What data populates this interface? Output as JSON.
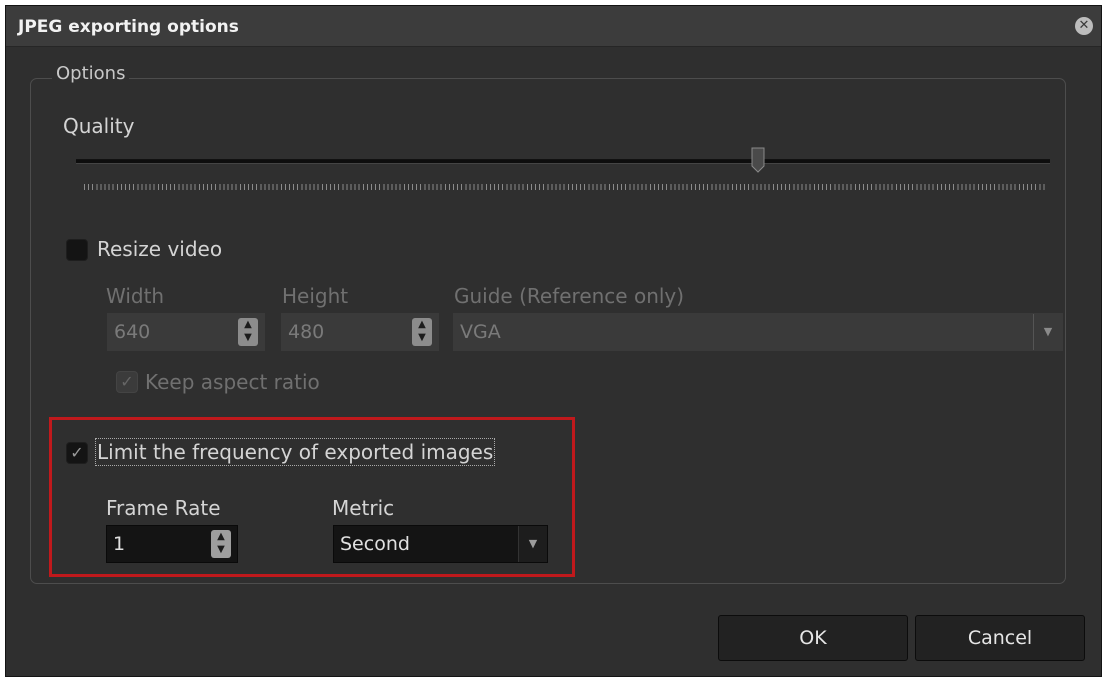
{
  "dialog": {
    "title": "JPEG exporting options"
  },
  "options": {
    "legend": "Options",
    "quality": {
      "label": "Quality",
      "value_percent": 70
    },
    "resize": {
      "checkbox_label": "Resize video",
      "checked": false,
      "width_label": "Width",
      "width_value": "640",
      "height_label": "Height",
      "height_value": "480",
      "guide_label": "Guide (Reference only)",
      "guide_value": "VGA",
      "keep_aspect_label": "Keep aspect ratio",
      "keep_aspect_checked": true
    },
    "limit": {
      "checkbox_label": "Limit the frequency of exported images",
      "checked": true,
      "frame_rate_label": "Frame Rate",
      "frame_rate_value": "1",
      "metric_label": "Metric",
      "metric_value": "Second"
    }
  },
  "buttons": {
    "ok": "OK",
    "cancel": "Cancel"
  },
  "colors": {
    "highlight": "#c0191c",
    "background": "#2f2f2f"
  },
  "icons": {
    "close": "close-icon",
    "check": "check-icon",
    "spin": "spin-arrows-icon",
    "dropdown": "chevron-down-icon"
  }
}
